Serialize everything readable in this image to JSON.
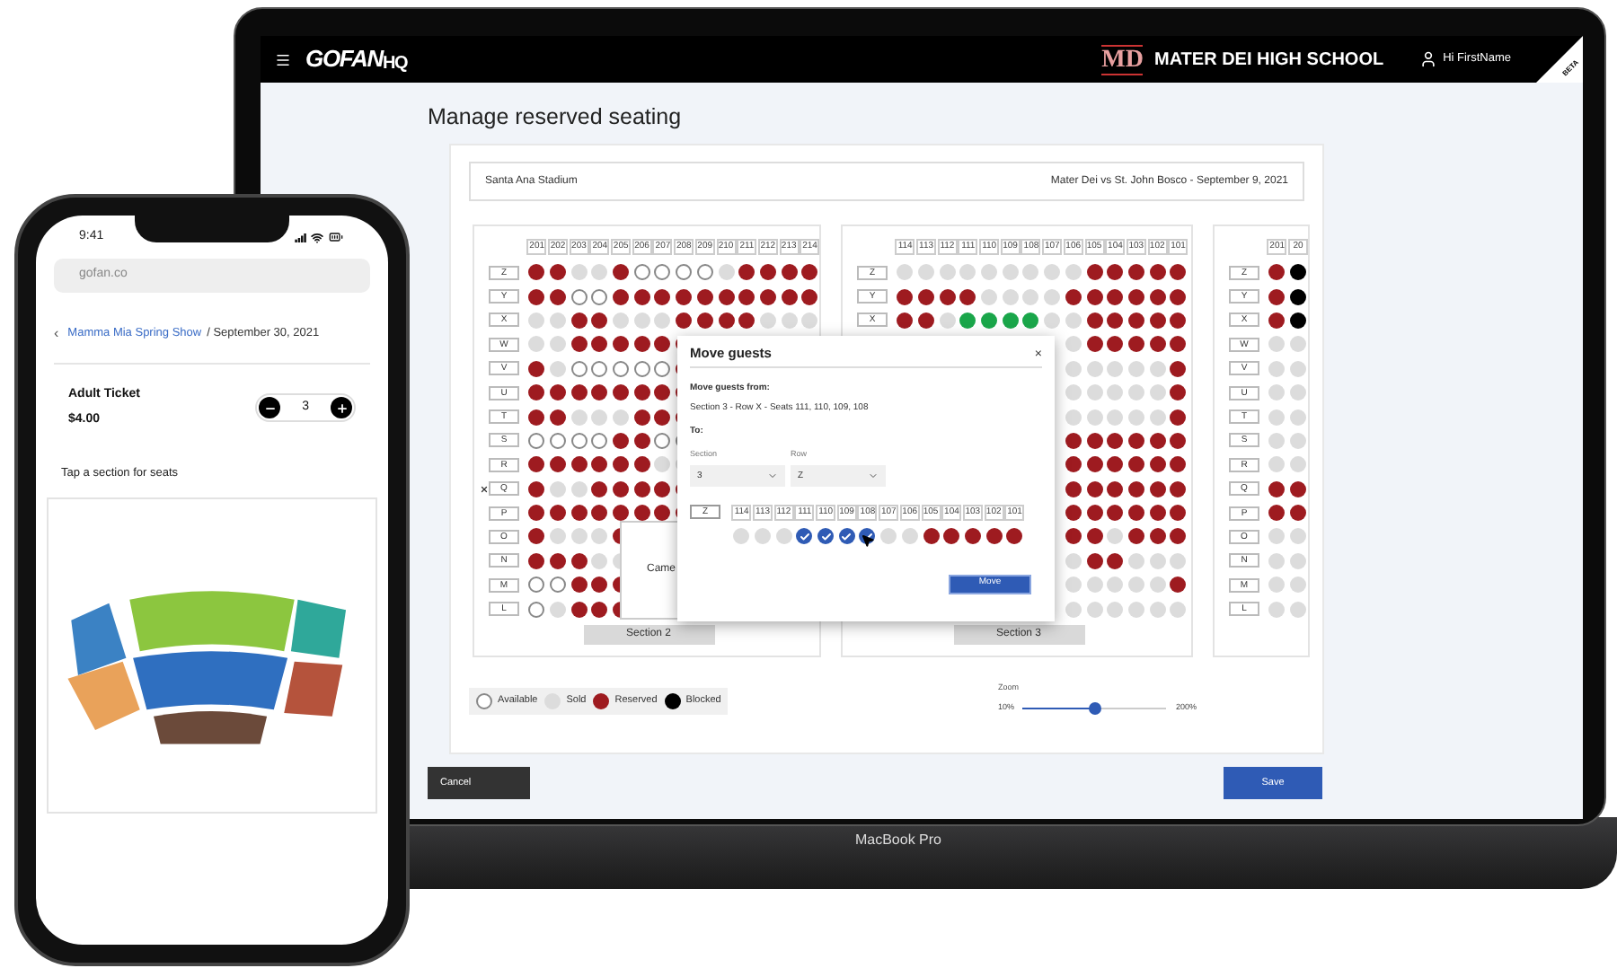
{
  "laptop": {
    "label": "MacBook Pro"
  },
  "header": {
    "logo": "GOFAN",
    "logo_sub": "HQ",
    "monogram": "MD",
    "school": "MATER DEI HIGH SCHOOL",
    "user": "Hi FirstName",
    "badge": "BETA"
  },
  "page_title": "Manage reserved seating",
  "venue": "Santa Ana Stadium",
  "event": "Mater Dei vs St. John Bosco - September 9, 2021",
  "sections": [
    {
      "label": "Section 2",
      "columns": [
        "201",
        "202",
        "203",
        "204",
        "205",
        "206",
        "207",
        "208",
        "209",
        "210",
        "211",
        "212",
        "213",
        "214"
      ],
      "rows": [
        {
          "label": "Z",
          "flagged": false,
          "seats": [
            {
              "kind": "reserved"
            },
            {
              "kind": "reserved"
            },
            {
              "kind": "sold"
            },
            {
              "kind": "sold"
            },
            {
              "kind": "reserved"
            },
            {
              "kind": "available"
            },
            {
              "kind": "available"
            },
            {
              "kind": "available"
            },
            {
              "kind": "available"
            },
            {
              "kind": "sold"
            },
            {
              "kind": "reserved"
            },
            {
              "kind": "reserved"
            },
            {
              "kind": "reserved"
            },
            {
              "kind": "reserved"
            }
          ]
        },
        {
          "label": "Y",
          "flagged": false,
          "seats": [
            {
              "kind": "reserved"
            },
            {
              "kind": "reserved"
            },
            {
              "kind": "available"
            },
            {
              "kind": "available"
            },
            {
              "kind": "reserved"
            },
            {
              "kind": "reserved"
            },
            {
              "kind": "reserved"
            },
            {
              "kind": "reserved"
            },
            {
              "kind": "reserved"
            },
            {
              "kind": "reserved"
            },
            {
              "kind": "reserved"
            },
            {
              "kind": "reserved"
            },
            {
              "kind": "reserved"
            },
            {
              "kind": "reserved"
            }
          ]
        },
        {
          "label": "X",
          "flagged": false,
          "seats": [
            {
              "kind": "sold"
            },
            {
              "kind": "sold"
            },
            {
              "kind": "reserved"
            },
            {
              "kind": "reserved"
            },
            {
              "kind": "sold"
            },
            {
              "kind": "sold"
            },
            {
              "kind": "sold"
            },
            {
              "kind": "reserved"
            },
            {
              "kind": "reserved"
            },
            {
              "kind": "reserved"
            },
            {
              "kind": "reserved"
            },
            {
              "kind": "sold"
            },
            {
              "kind": "sold"
            },
            {
              "kind": "sold"
            }
          ]
        },
        {
          "label": "W",
          "flagged": false,
          "seats": [
            {
              "kind": "sold"
            },
            {
              "kind": "sold"
            },
            {
              "kind": "reserved"
            },
            {
              "kind": "reserved"
            },
            {
              "kind": "reserved"
            },
            {
              "kind": "reserved"
            },
            {
              "kind": "reserved"
            },
            {
              "kind": "reserved"
            }
          ]
        },
        {
          "label": "V",
          "flagged": false,
          "seats": [
            {
              "kind": "reserved"
            },
            {
              "kind": "sold"
            },
            {
              "kind": "available"
            },
            {
              "kind": "available"
            },
            {
              "kind": "available"
            },
            {
              "kind": "available"
            },
            {
              "kind": "available"
            },
            {
              "kind": "reserved"
            }
          ]
        },
        {
          "label": "U",
          "flagged": false,
          "seats": [
            {
              "kind": "reserved"
            },
            {
              "kind": "reserved"
            },
            {
              "kind": "reserved"
            },
            {
              "kind": "reserved"
            },
            {
              "kind": "reserved"
            },
            {
              "kind": "reserved"
            },
            {
              "kind": "reserved"
            },
            {
              "kind": "reserved"
            }
          ]
        },
        {
          "label": "T",
          "flagged": false,
          "seats": [
            {
              "kind": "reserved"
            },
            {
              "kind": "reserved"
            },
            {
              "kind": "sold"
            },
            {
              "kind": "sold"
            },
            {
              "kind": "sold"
            },
            {
              "kind": "reserved"
            },
            {
              "kind": "reserved"
            },
            {
              "kind": "reserved"
            }
          ]
        },
        {
          "label": "S",
          "flagged": false,
          "seats": [
            {
              "kind": "available"
            },
            {
              "kind": "available"
            },
            {
              "kind": "available"
            },
            {
              "kind": "available"
            },
            {
              "kind": "reserved"
            },
            {
              "kind": "reserved"
            },
            {
              "kind": "available"
            },
            {
              "kind": "available"
            }
          ]
        },
        {
          "label": "R",
          "flagged": false,
          "seats": [
            {
              "kind": "reserved"
            },
            {
              "kind": "reserved"
            },
            {
              "kind": "reserved"
            },
            {
              "kind": "reserved"
            },
            {
              "kind": "reserved"
            },
            {
              "kind": "reserved"
            },
            {
              "kind": "sold"
            },
            {
              "kind": "sold"
            }
          ]
        },
        {
          "label": "Q",
          "flagged": true,
          "seats": [
            {
              "kind": "reserved"
            },
            {
              "kind": "sold"
            },
            {
              "kind": "sold"
            },
            {
              "kind": "reserved"
            },
            {
              "kind": "reserved"
            },
            {
              "kind": "reserved"
            },
            {
              "kind": "reserved"
            },
            {
              "kind": "reserved"
            }
          ]
        },
        {
          "label": "P",
          "flagged": false,
          "seats": [
            {
              "kind": "reserved"
            },
            {
              "kind": "reserved"
            },
            {
              "kind": "reserved"
            },
            {
              "kind": "reserved"
            },
            {
              "kind": "reserved"
            },
            {
              "kind": "reserved"
            },
            {
              "kind": "reserved"
            },
            {
              "kind": "reserved"
            }
          ]
        },
        {
          "label": "O",
          "flagged": false,
          "seats": [
            {
              "kind": "reserved"
            },
            {
              "kind": "sold"
            },
            {
              "kind": "sold"
            },
            {
              "kind": "sold"
            },
            {
              "kind": "reserved"
            }
          ]
        },
        {
          "label": "N",
          "flagged": false,
          "seats": [
            {
              "kind": "reserved"
            },
            {
              "kind": "reserved"
            },
            {
              "kind": "reserved"
            },
            {
              "kind": "sold"
            },
            {
              "kind": "sold"
            }
          ]
        },
        {
          "label": "M",
          "flagged": false,
          "seats": [
            {
              "kind": "available"
            },
            {
              "kind": "available"
            },
            {
              "kind": "reserved"
            },
            {
              "kind": "reserved"
            },
            {
              "kind": "reserved"
            }
          ]
        },
        {
          "label": "L",
          "flagged": false,
          "seats": [
            {
              "kind": "available"
            },
            {
              "kind": "sold"
            },
            {
              "kind": "reserved"
            },
            {
              "kind": "reserved"
            },
            {
              "kind": "reserved"
            }
          ]
        }
      ]
    },
    {
      "label": "Section 3",
      "columns": [
        "114",
        "113",
        "112",
        "111",
        "110",
        "109",
        "108",
        "107",
        "106",
        "105",
        "104",
        "103",
        "102",
        "101"
      ],
      "rows": [
        {
          "label": "Z",
          "flagged": false,
          "seats": [
            {
              "kind": "sold"
            },
            {
              "kind": "sold"
            },
            {
              "kind": "sold"
            },
            {
              "kind": "sold"
            },
            {
              "kind": "sold"
            },
            {
              "kind": "sold"
            },
            {
              "kind": "sold"
            },
            {
              "kind": "sold"
            },
            {
              "kind": "sold"
            },
            {
              "kind": "reserved"
            },
            {
              "kind": "reserved"
            },
            {
              "kind": "reserved"
            },
            {
              "kind": "reserved"
            },
            {
              "kind": "reserved"
            }
          ]
        },
        {
          "label": "Y",
          "flagged": false,
          "seats": [
            {
              "kind": "reserved"
            },
            {
              "kind": "reserved"
            },
            {
              "kind": "reserved"
            },
            {
              "kind": "reserved"
            },
            {
              "kind": "sold"
            },
            {
              "kind": "sold"
            },
            {
              "kind": "sold"
            },
            {
              "kind": "sold"
            },
            {
              "kind": "reserved"
            },
            {
              "kind": "reserved"
            },
            {
              "kind": "reserved"
            },
            {
              "kind": "reserved"
            },
            {
              "kind": "reserved"
            },
            {
              "kind": "reserved"
            }
          ]
        },
        {
          "label": "X",
          "flagged": false,
          "seats": [
            {
              "kind": "reserved"
            },
            {
              "kind": "reserved"
            },
            {
              "kind": "sold"
            },
            {
              "kind": "selected"
            },
            {
              "kind": "selected"
            },
            {
              "kind": "selected"
            },
            {
              "kind": "selected"
            },
            {
              "kind": "sold"
            },
            {
              "kind": "sold"
            },
            {
              "kind": "reserved"
            },
            {
              "kind": "reserved"
            },
            {
              "kind": "reserved"
            },
            {
              "kind": "reserved"
            },
            {
              "kind": "reserved"
            }
          ]
        },
        {
          "seats": [
            {
              "kind": "hidden"
            },
            {
              "kind": "hidden"
            },
            {
              "kind": "hidden"
            },
            {
              "kind": "hidden"
            },
            {
              "kind": "hidden"
            },
            {
              "kind": "hidden"
            },
            {
              "kind": "hidden"
            },
            {
              "kind": "hidden"
            },
            {
              "kind": "sold"
            },
            {
              "kind": "reserved"
            },
            {
              "kind": "reserved"
            },
            {
              "kind": "reserved"
            },
            {
              "kind": "reserved"
            },
            {
              "kind": "reserved"
            }
          ]
        },
        {
          "seats": [
            {
              "kind": "hidden"
            },
            {
              "kind": "hidden"
            },
            {
              "kind": "hidden"
            },
            {
              "kind": "hidden"
            },
            {
              "kind": "hidden"
            },
            {
              "kind": "hidden"
            },
            {
              "kind": "hidden"
            },
            {
              "kind": "hidden"
            },
            {
              "kind": "sold"
            },
            {
              "kind": "sold"
            },
            {
              "kind": "sold"
            },
            {
              "kind": "sold"
            },
            {
              "kind": "sold"
            },
            {
              "kind": "reserved"
            }
          ]
        },
        {
          "seats": [
            {
              "kind": "hidden"
            },
            {
              "kind": "hidden"
            },
            {
              "kind": "hidden"
            },
            {
              "kind": "hidden"
            },
            {
              "kind": "hidden"
            },
            {
              "kind": "hidden"
            },
            {
              "kind": "hidden"
            },
            {
              "kind": "hidden"
            },
            {
              "kind": "sold"
            },
            {
              "kind": "sold"
            },
            {
              "kind": "sold"
            },
            {
              "kind": "sold"
            },
            {
              "kind": "sold"
            },
            {
              "kind": "reserved"
            }
          ]
        },
        {
          "seats": [
            {
              "kind": "hidden"
            },
            {
              "kind": "hidden"
            },
            {
              "kind": "hidden"
            },
            {
              "kind": "hidden"
            },
            {
              "kind": "hidden"
            },
            {
              "kind": "hidden"
            },
            {
              "kind": "hidden"
            },
            {
              "kind": "hidden"
            },
            {
              "kind": "sold"
            },
            {
              "kind": "sold"
            },
            {
              "kind": "sold"
            },
            {
              "kind": "sold"
            },
            {
              "kind": "sold"
            },
            {
              "kind": "reserved"
            }
          ]
        },
        {
          "seats": [
            {
              "kind": "hidden"
            },
            {
              "kind": "hidden"
            },
            {
              "kind": "hidden"
            },
            {
              "kind": "hidden"
            },
            {
              "kind": "hidden"
            },
            {
              "kind": "hidden"
            },
            {
              "kind": "hidden"
            },
            {
              "kind": "hidden"
            },
            {
              "kind": "reserved"
            },
            {
              "kind": "reserved"
            },
            {
              "kind": "reserved"
            },
            {
              "kind": "reserved"
            },
            {
              "kind": "reserved"
            },
            {
              "kind": "reserved"
            }
          ]
        },
        {
          "seats": [
            {
              "kind": "hidden"
            },
            {
              "kind": "hidden"
            },
            {
              "kind": "hidden"
            },
            {
              "kind": "hidden"
            },
            {
              "kind": "hidden"
            },
            {
              "kind": "hidden"
            },
            {
              "kind": "hidden"
            },
            {
              "kind": "hidden"
            },
            {
              "kind": "reserved"
            },
            {
              "kind": "reserved"
            },
            {
              "kind": "reserved"
            },
            {
              "kind": "reserved"
            },
            {
              "kind": "reserved"
            },
            {
              "kind": "reserved"
            }
          ]
        },
        {
          "seats": [
            {
              "kind": "hidden"
            },
            {
              "kind": "hidden"
            },
            {
              "kind": "hidden"
            },
            {
              "kind": "hidden"
            },
            {
              "kind": "hidden"
            },
            {
              "kind": "hidden"
            },
            {
              "kind": "hidden"
            },
            {
              "kind": "hidden"
            },
            {
              "kind": "reserved"
            },
            {
              "kind": "reserved"
            },
            {
              "kind": "reserved"
            },
            {
              "kind": "reserved"
            },
            {
              "kind": "reserved"
            },
            {
              "kind": "reserved"
            }
          ]
        },
        {
          "seats": [
            {
              "kind": "hidden"
            },
            {
              "kind": "hidden"
            },
            {
              "kind": "hidden"
            },
            {
              "kind": "hidden"
            },
            {
              "kind": "hidden"
            },
            {
              "kind": "hidden"
            },
            {
              "kind": "hidden"
            },
            {
              "kind": "hidden"
            },
            {
              "kind": "reserved"
            },
            {
              "kind": "reserved"
            },
            {
              "kind": "reserved"
            },
            {
              "kind": "reserved"
            },
            {
              "kind": "reserved"
            },
            {
              "kind": "reserved"
            }
          ]
        },
        {
          "seats": [
            {
              "kind": "hidden"
            },
            {
              "kind": "hidden"
            },
            {
              "kind": "hidden"
            },
            {
              "kind": "hidden"
            },
            {
              "kind": "hidden"
            },
            {
              "kind": "hidden"
            },
            {
              "kind": "hidden"
            },
            {
              "kind": "hidden"
            },
            {
              "kind": "reserved"
            },
            {
              "kind": "reserved"
            },
            {
              "kind": "sold"
            },
            {
              "kind": "reserved"
            },
            {
              "kind": "reserved"
            },
            {
              "kind": "reserved"
            }
          ]
        },
        {
          "seats": [
            {
              "kind": "hidden"
            },
            {
              "kind": "hidden"
            },
            {
              "kind": "hidden"
            },
            {
              "kind": "hidden"
            },
            {
              "kind": "hidden"
            },
            {
              "kind": "hidden"
            },
            {
              "kind": "hidden"
            },
            {
              "kind": "hidden"
            },
            {
              "kind": "sold"
            },
            {
              "kind": "reserved"
            },
            {
              "kind": "reserved"
            },
            {
              "kind": "sold"
            },
            {
              "kind": "sold"
            },
            {
              "kind": "sold"
            }
          ]
        },
        {
          "seats": [
            {
              "kind": "hidden"
            },
            {
              "kind": "hidden"
            },
            {
              "kind": "hidden"
            },
            {
              "kind": "hidden"
            },
            {
              "kind": "hidden"
            },
            {
              "kind": "hidden"
            },
            {
              "kind": "hidden"
            },
            {
              "kind": "hidden"
            },
            {
              "kind": "sold"
            },
            {
              "kind": "sold"
            },
            {
              "kind": "sold"
            },
            {
              "kind": "sold"
            },
            {
              "kind": "sold"
            },
            {
              "kind": "reserved"
            }
          ]
        },
        {
          "seats": [
            {
              "kind": "hidden"
            },
            {
              "kind": "hidden"
            },
            {
              "kind": "hidden"
            },
            {
              "kind": "hidden"
            },
            {
              "kind": "hidden"
            },
            {
              "kind": "hidden"
            },
            {
              "kind": "hidden"
            },
            {
              "kind": "hidden"
            },
            {
              "kind": "sold"
            },
            {
              "kind": "sold"
            },
            {
              "kind": "sold"
            },
            {
              "kind": "sold"
            },
            {
              "kind": "sold"
            },
            {
              "kind": "sold"
            }
          ]
        }
      ]
    },
    {
      "columns": [
        "201",
        "20"
      ],
      "rows": [
        {
          "label": "Z",
          "flagged": false,
          "seats": [
            {
              "kind": "reserved"
            },
            {
              "kind": "blocked"
            }
          ]
        },
        {
          "label": "Y",
          "flagged": false,
          "seats": [
            {
              "kind": "reserved"
            },
            {
              "kind": "blocked"
            }
          ]
        },
        {
          "label": "X",
          "flagged": false,
          "seats": [
            {
              "kind": "reserved"
            },
            {
              "kind": "blocked"
            }
          ]
        },
        {
          "label": "W",
          "flagged": false,
          "seats": [
            {
              "kind": "sold"
            },
            {
              "kind": "sold"
            }
          ]
        },
        {
          "label": "V",
          "flagged": false,
          "seats": [
            {
              "kind": "sold"
            },
            {
              "kind": "sold"
            }
          ]
        },
        {
          "label": "U",
          "flagged": false,
          "seats": [
            {
              "kind": "sold"
            },
            {
              "kind": "sold"
            }
          ]
        },
        {
          "label": "T",
          "flagged": false,
          "seats": [
            {
              "kind": "sold"
            },
            {
              "kind": "sold"
            }
          ]
        },
        {
          "label": "S",
          "flagged": false,
          "seats": [
            {
              "kind": "sold"
            },
            {
              "kind": "sold"
            }
          ]
        },
        {
          "label": "R",
          "flagged": false,
          "seats": [
            {
              "kind": "sold"
            },
            {
              "kind": "sold"
            }
          ]
        },
        {
          "label": "Q",
          "flagged": false,
          "seats": [
            {
              "kind": "reserved"
            },
            {
              "kind": "reserved"
            }
          ]
        },
        {
          "label": "P",
          "flagged": false,
          "seats": [
            {
              "kind": "reserved"
            },
            {
              "kind": "reserved"
            }
          ]
        },
        {
          "label": "O",
          "flagged": false,
          "seats": [
            {
              "kind": "sold"
            },
            {
              "kind": "sold"
            }
          ]
        },
        {
          "label": "N",
          "flagged": false,
          "seats": [
            {
              "kind": "sold"
            },
            {
              "kind": "sold"
            }
          ]
        },
        {
          "label": "M",
          "flagged": false,
          "seats": [
            {
              "kind": "sold"
            },
            {
              "kind": "sold"
            }
          ]
        },
        {
          "label": "L",
          "flagged": false,
          "seats": [
            {
              "kind": "sold"
            },
            {
              "kind": "sold"
            }
          ]
        }
      ]
    }
  ],
  "camera_box": {
    "text": "Came"
  },
  "dialog": {
    "title": "Move guests",
    "close": "×",
    "from_label": "Move guests from:",
    "from_text": "Section 3 - Row X - Seats 111, 110, 109, 108",
    "to_label": "To:",
    "section_label": "Section",
    "section_value": "3",
    "row_label": "Row",
    "row_value": "Z",
    "row_field": "Z",
    "columns": [
      "114",
      "113",
      "112",
      "111",
      "110",
      "109",
      "108",
      "107",
      "106",
      "105",
      "104",
      "103",
      "102",
      "101"
    ],
    "seats": [
      {
        "kind": "sold"
      },
      {
        "kind": "sold"
      },
      {
        "kind": "sold"
      },
      {
        "kind": "checked"
      },
      {
        "kind": "checked"
      },
      {
        "kind": "checked"
      },
      {
        "kind": "checked"
      },
      {
        "kind": "sold"
      },
      {
        "kind": "sold"
      },
      {
        "kind": "reserved"
      },
      {
        "kind": "reserved"
      },
      {
        "kind": "reserved"
      },
      {
        "kind": "reserved"
      },
      {
        "kind": "reserved"
      }
    ],
    "button": "Move"
  },
  "legend": [
    {
      "kind": "available",
      "label": "Available"
    },
    {
      "kind": "sold",
      "label": "Sold"
    },
    {
      "kind": "reserved",
      "label": "Reserved"
    },
    {
      "kind": "blocked",
      "label": "Blocked"
    }
  ],
  "zoom": {
    "label": "Zoom",
    "min": "10%",
    "max": "200%",
    "level": 0.5
  },
  "cancel": "Cancel",
  "save": "Save",
  "phone": {
    "time": "9:41",
    "url": "gofan.co",
    "back": "‹",
    "event_link": "Mamma Mia Spring Show",
    "event_date": "/ September 30, 2021",
    "ticket": "Adult Ticket",
    "price": "$4.00",
    "quantity": "3",
    "hint": "Tap a section for seats"
  }
}
